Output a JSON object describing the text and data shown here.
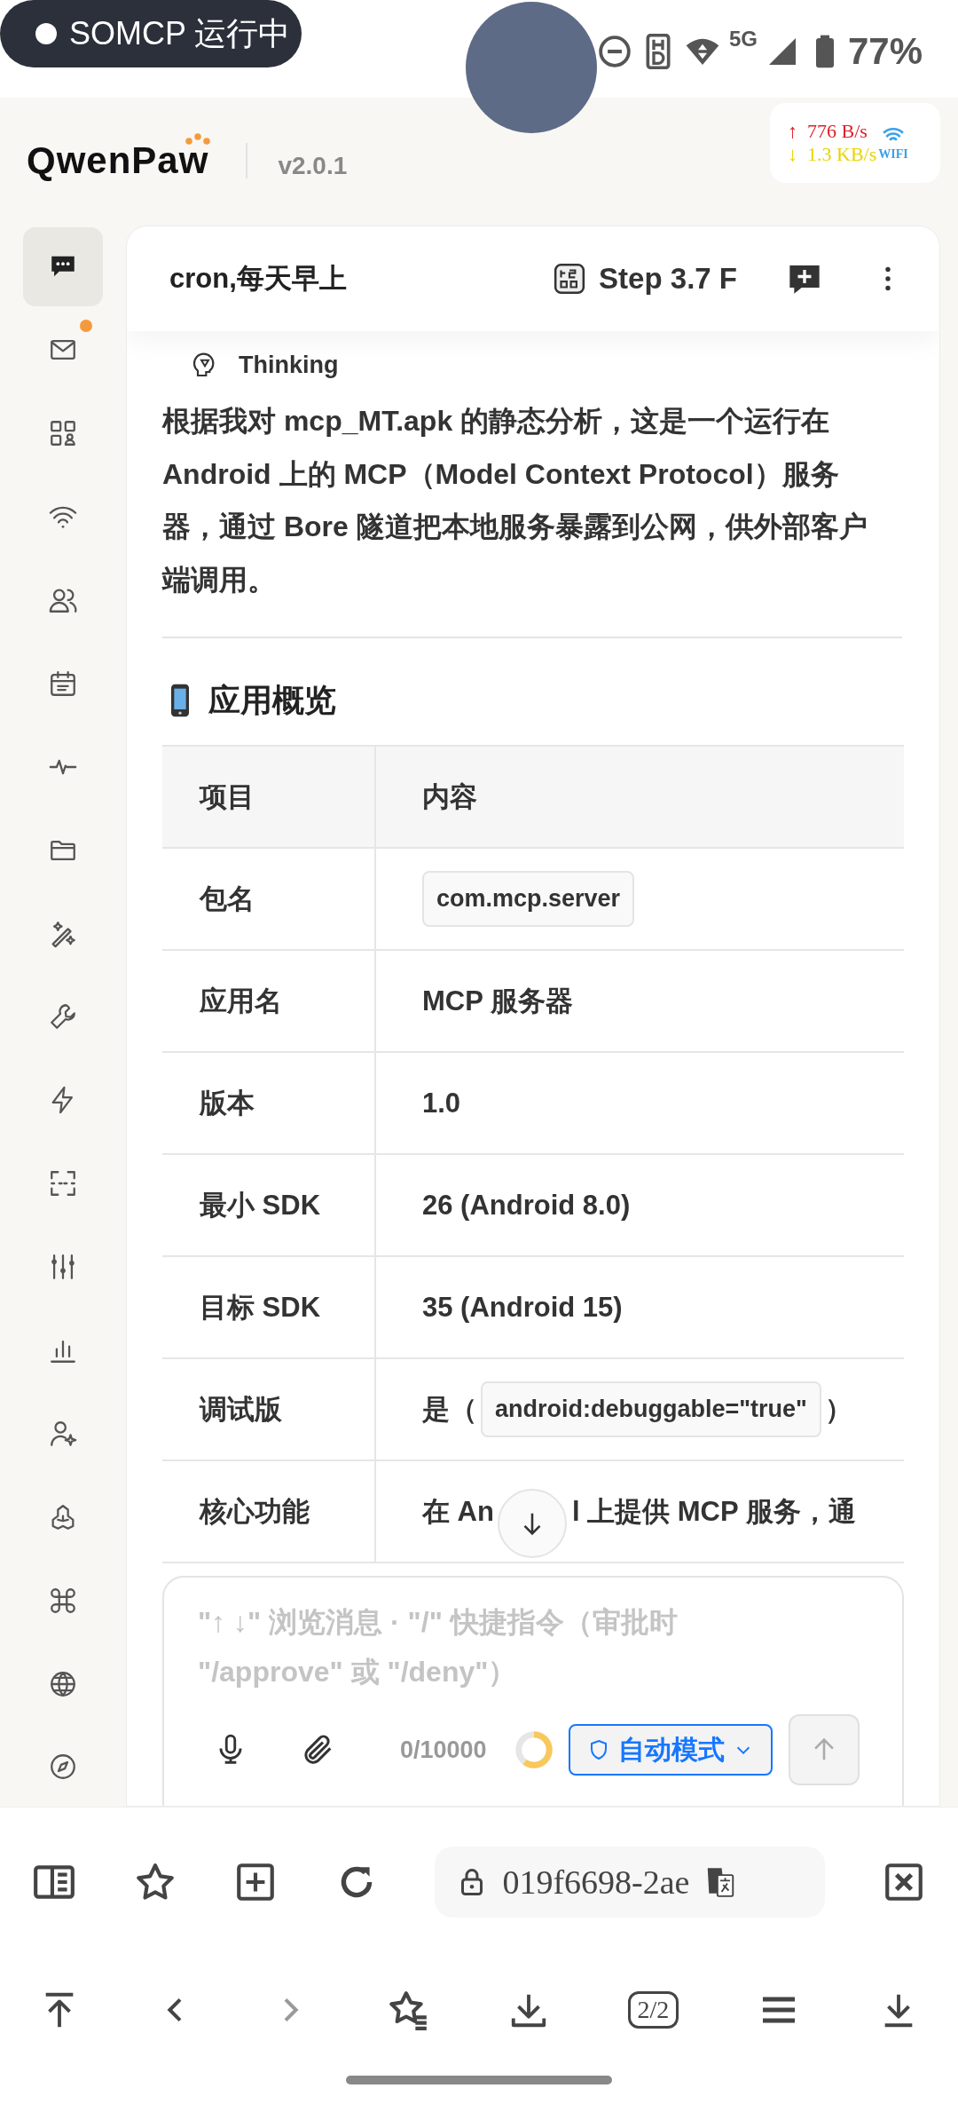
{
  "status_bar": {
    "notification": "SOMCP 运行中",
    "network_type": "5G",
    "battery": "77%"
  },
  "app_header": {
    "logo": "QwenPaw",
    "version": "v2.0.1"
  },
  "net_speed": {
    "upload": "↑  776 B/s",
    "download": "↓  1.3 KB/s",
    "network": "WIFI"
  },
  "sidebar": {
    "items": [
      {
        "selected": true,
        "unread": false
      },
      {
        "selected": false,
        "unread": true
      },
      {
        "selected": false,
        "unread": false
      },
      {
        "selected": false,
        "unread": false
      },
      {
        "selected": false,
        "unread": false
      },
      {
        "selected": false,
        "unread": false
      },
      {
        "selected": false,
        "unread": false
      },
      {
        "selected": false,
        "unread": false
      },
      {
        "selected": false,
        "unread": false
      },
      {
        "selected": false,
        "unread": false
      },
      {
        "selected": false,
        "unread": false
      },
      {
        "selected": false,
        "unread": false
      },
      {
        "selected": false,
        "unread": false
      },
      {
        "selected": false,
        "unread": false
      },
      {
        "selected": false,
        "unread": false
      },
      {
        "selected": false,
        "unread": false
      },
      {
        "selected": false,
        "unread": false
      },
      {
        "selected": false,
        "unread": false
      },
      {
        "selected": false,
        "unread": false
      }
    ]
  },
  "chat": {
    "title": "cron,每天早上",
    "model": "Step 3.7 F",
    "thinking": "Thinking",
    "paragraph": "根据我对 mcp_MT.apk 的静态分析，这是一个运行在 Android 上的 MCP（Model Context Protocol）服务器，通过 Bore 隧道把本地服务暴露到公网，供外部客户端调用。",
    "heading": "应用概览",
    "table": {
      "columns": [
        "项目",
        "内容"
      ],
      "rows": [
        {
          "label": "包名",
          "parts": [
            {
              "kind": "code",
              "text": "com.mcp.server"
            }
          ]
        },
        {
          "label": "应用名",
          "parts": [
            {
              "kind": "text",
              "text": "MCP 服务器"
            }
          ]
        },
        {
          "label": "版本",
          "parts": [
            {
              "kind": "text",
              "text": "1.0"
            }
          ]
        },
        {
          "label": "最小 SDK",
          "parts": [
            {
              "kind": "text",
              "text": "26 (Android 8.0)"
            }
          ]
        },
        {
          "label": "目标 SDK",
          "parts": [
            {
              "kind": "text",
              "text": "35 (Android 15)"
            }
          ]
        },
        {
          "label": "调试版",
          "parts": [
            {
              "kind": "text",
              "text": "是（"
            },
            {
              "kind": "code",
              "text": "android:debuggable=\"true\""
            },
            {
              "kind": "text",
              "text": "）"
            }
          ]
        },
        {
          "label": "核心功能",
          "parts": [
            {
              "kind": "text",
              "text": "在 An"
            },
            {
              "kind": "text_after_overlay",
              "text": "l 上提供 MCP 服务，通"
            }
          ]
        }
      ]
    }
  },
  "composer": {
    "placeholder": "\"↑ ↓\" 浏览消息 · \"/\" 快捷指令（审批时 \"/approve\" 或 \"/deny\"）",
    "count": "0/10000",
    "context_usage": {
      "level": 0.6
    },
    "mode": "自动模式"
  },
  "browser": {
    "url": "019f6698-2ae",
    "tab_count": "2/2"
  }
}
